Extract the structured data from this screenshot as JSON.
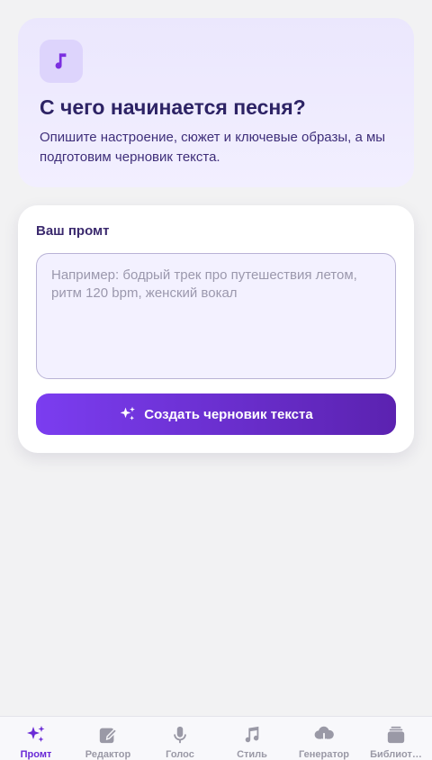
{
  "colors": {
    "accent": "#7b3df0",
    "accent_dark": "#5b22b0",
    "title": "#2d2365",
    "inactive_tab": "#9a99a6"
  },
  "hero": {
    "icon": "music-note-icon",
    "title": "С чего начинается песня?",
    "description": "Опишите настроение, сюжет и ключевые образы, а мы подготовим черновик текста."
  },
  "prompt_card": {
    "label": "Ваш промт",
    "input_value": "",
    "placeholder": "Например: бодрый трек про путешествия летом, ритм 120 bpm, женский вокал",
    "create_button": {
      "icon": "sparkles-icon",
      "label": "Создать черновик текста"
    }
  },
  "tabbar": {
    "active": "Промт",
    "tabs": [
      {
        "label": "Промт",
        "icon": "sparkles-icon"
      },
      {
        "label": "Редактор",
        "icon": "edit-icon"
      },
      {
        "label": "Голос",
        "icon": "microphone-icon"
      },
      {
        "label": "Стиль",
        "icon": "music-note-icon"
      },
      {
        "label": "Генератор",
        "icon": "cloud-icon"
      },
      {
        "label": "Библиот…",
        "icon": "library-icon"
      }
    ]
  }
}
